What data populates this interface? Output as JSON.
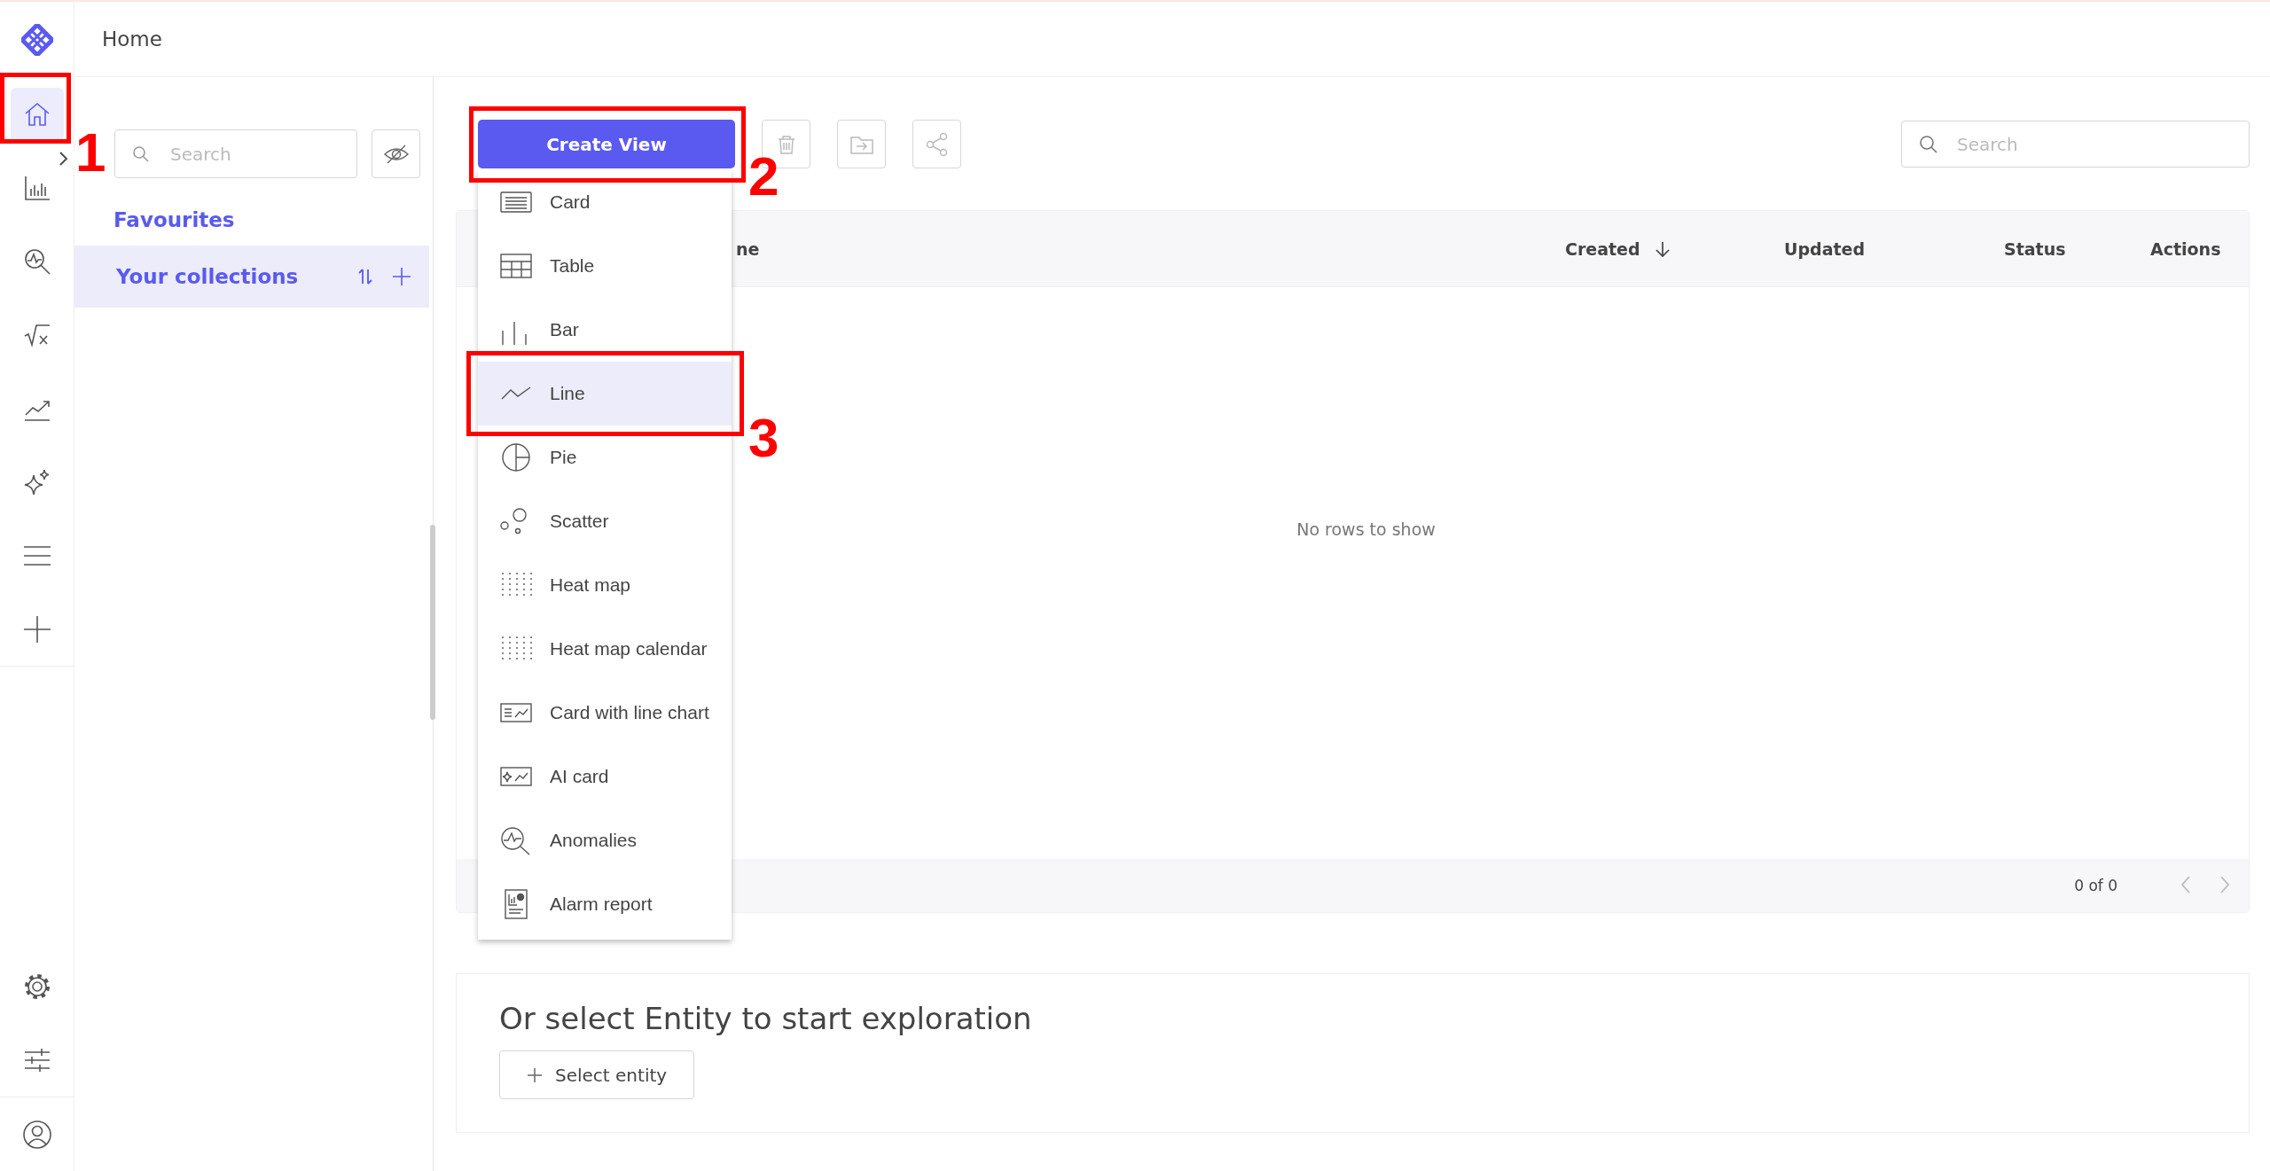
{
  "header": {
    "title": "Home"
  },
  "rail": {
    "top": [
      {
        "selected": true,
        "callout": "1"
      },
      {
        "selected": false
      },
      {
        "selected": false
      },
      {
        "selected": false
      },
      {
        "selected": false
      },
      {
        "selected": false
      },
      {
        "selected": false
      },
      {
        "selected": false
      }
    ],
    "bottom": [
      {
        "selected": false
      },
      {
        "selected": false
      },
      {
        "selected": false
      }
    ]
  },
  "collections_panel": {
    "search": {
      "placeholder": "Search"
    },
    "favourites": "Favourites",
    "collections": {
      "label": "Your collections",
      "selected": true
    }
  },
  "toolbar": {
    "create_button": {
      "label": "Create View",
      "callout": "2"
    },
    "search": {
      "placeholder": "Search"
    }
  },
  "create_menu": {
    "items": [
      {
        "label": "Card",
        "selected": false
      },
      {
        "label": "Table",
        "selected": false
      },
      {
        "label": "Bar",
        "selected": false
      },
      {
        "label": "Line",
        "selected": true,
        "callout": "3"
      },
      {
        "label": "Pie",
        "selected": false
      },
      {
        "label": "Scatter",
        "selected": false
      },
      {
        "label": "Heat map",
        "selected": false
      },
      {
        "label": "Heat map calendar",
        "selected": false
      },
      {
        "label": "Card with line chart",
        "selected": false
      },
      {
        "label": "AI card",
        "selected": false
      },
      {
        "label": "Anomalies",
        "selected": false
      },
      {
        "label": "Alarm report",
        "selected": false
      }
    ]
  },
  "table": {
    "columns": [
      {
        "label": "ne",
        "sorted": false
      },
      {
        "label": "Created",
        "sorted": true
      },
      {
        "label": "Updated",
        "sorted": false
      },
      {
        "label": "Status",
        "sorted": false
      },
      {
        "label": "Actions",
        "sorted": false
      }
    ],
    "empty_text": "No rows to show",
    "pagination": "0 of 0"
  },
  "exploration": {
    "title": "Or select Entity to start exploration",
    "button": "Select entity"
  }
}
